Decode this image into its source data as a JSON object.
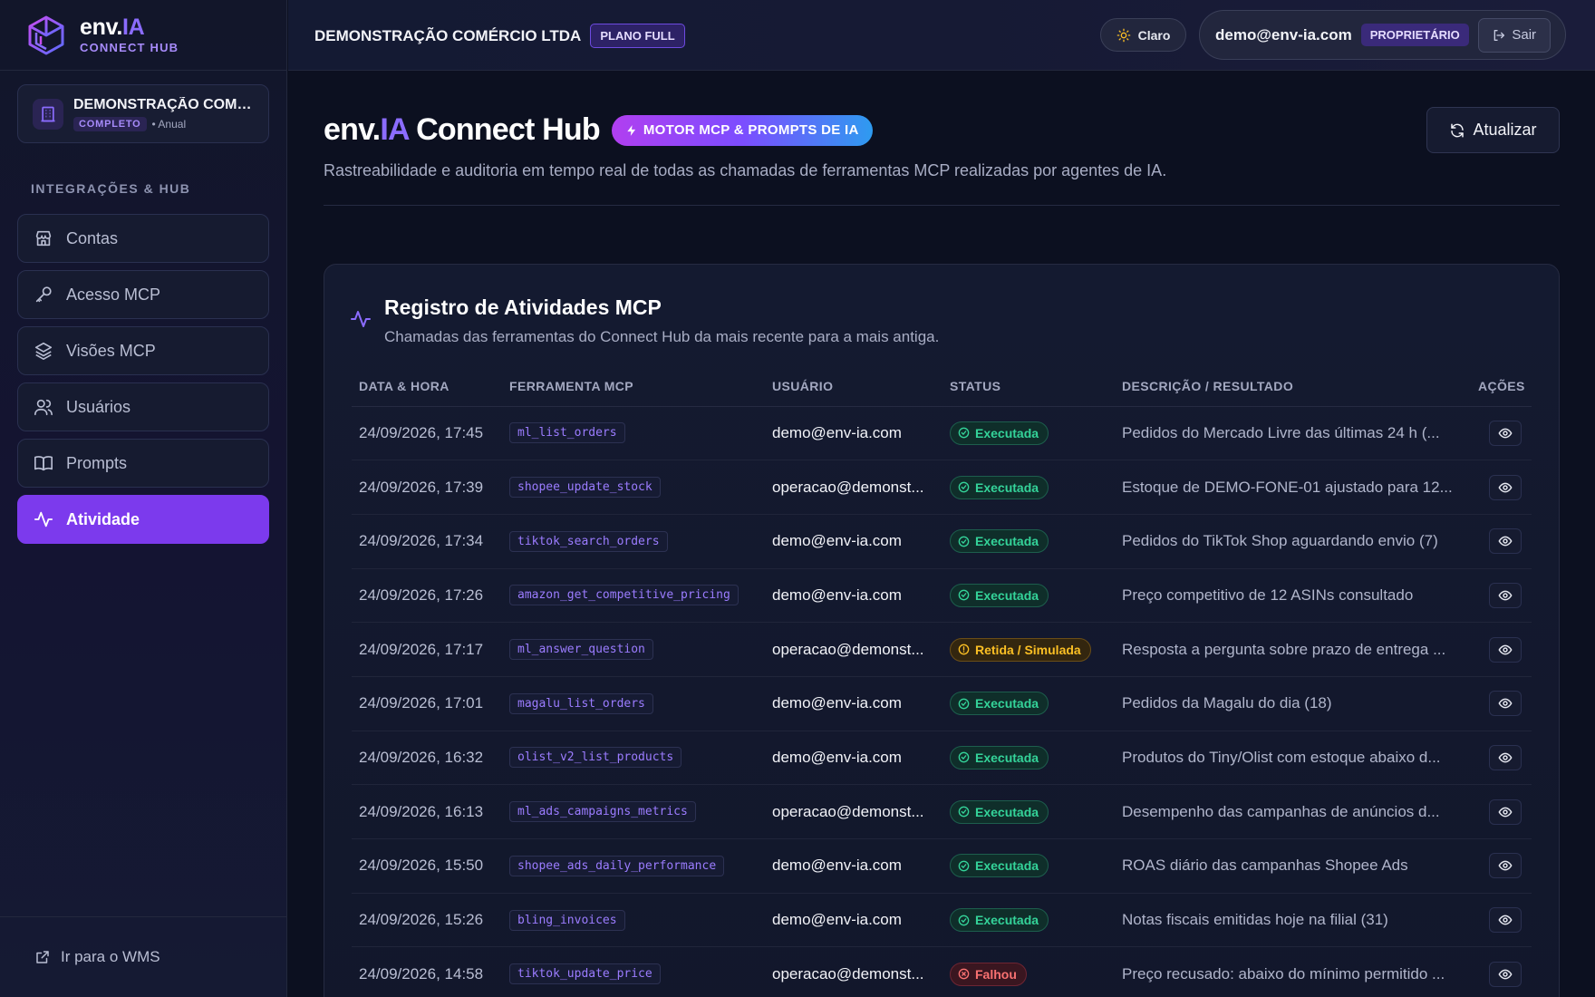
{
  "brand": {
    "name_prefix": "env.",
    "name_ia": "IA",
    "subtitle": "CONNECT HUB"
  },
  "org": {
    "name": "DEMONSTRAÇÃO COMÉRCIO LTDA",
    "plan_badge": "COMPLETO",
    "billing": "• Anual"
  },
  "sidebar": {
    "section_label": "INTEGRAÇÕES & HUB",
    "items": [
      {
        "label": "Contas",
        "icon": "store-icon",
        "active": false
      },
      {
        "label": "Acesso MCP",
        "icon": "key-icon",
        "active": false
      },
      {
        "label": "Visões MCP",
        "icon": "layers-icon",
        "active": false
      },
      {
        "label": "Usuários",
        "icon": "users-icon",
        "active": false
      },
      {
        "label": "Prompts",
        "icon": "book-icon",
        "active": false
      },
      {
        "label": "Atividade",
        "icon": "activity-icon",
        "active": true
      }
    ],
    "footer_link": "Ir para o WMS"
  },
  "header": {
    "company": "DEMONSTRAÇÃO COMÉRCIO LTDA",
    "plan": "PLANO FULL",
    "theme_label": "Claro",
    "user_email": "demo@env-ia.com",
    "role": "PROPRIETÁRIO",
    "logout_label": "Sair"
  },
  "page": {
    "title_prefix": "env.",
    "title_ia": "IA",
    "title_suffix": "Connect Hub",
    "engine_badge": "MOTOR MCP & PROMPTS DE IA",
    "subtitle": "Rastreabilidade e auditoria em tempo real de todas as chamadas de ferramentas MCP realizadas por agentes de IA.",
    "refresh_label": "Atualizar"
  },
  "activity": {
    "title": "Registro de Atividades MCP",
    "subtitle": "Chamadas das ferramentas do Connect Hub da mais recente para a mais antiga.",
    "columns": [
      "DATA & HORA",
      "FERRAMENTA MCP",
      "USUÁRIO",
      "STATUS",
      "DESCRIÇÃO / RESULTADO",
      "AÇÕES"
    ],
    "rows": [
      {
        "datetime": "24/09/2026, 17:45",
        "tool": "ml_list_orders",
        "user": "demo@env-ia.com",
        "status": "Executada",
        "status_type": "ok",
        "description": "Pedidos do Mercado Livre das últimas 24 h (..."
      },
      {
        "datetime": "24/09/2026, 17:39",
        "tool": "shopee_update_stock",
        "user": "operacao@demonst...",
        "status": "Executada",
        "status_type": "ok",
        "description": "Estoque de DEMO-FONE-01 ajustado para 12..."
      },
      {
        "datetime": "24/09/2026, 17:34",
        "tool": "tiktok_search_orders",
        "user": "demo@env-ia.com",
        "status": "Executada",
        "status_type": "ok",
        "description": "Pedidos do TikTok Shop aguardando envio (7)"
      },
      {
        "datetime": "24/09/2026, 17:26",
        "tool": "amazon_get_competitive_pricing",
        "user": "demo@env-ia.com",
        "status": "Executada",
        "status_type": "ok",
        "description": "Preço competitivo de 12 ASINs consultado"
      },
      {
        "datetime": "24/09/2026, 17:17",
        "tool": "ml_answer_question",
        "user": "operacao@demonst...",
        "status": "Retida / Simulada",
        "status_type": "warn",
        "description": "Resposta a pergunta sobre prazo de entrega ..."
      },
      {
        "datetime": "24/09/2026, 17:01",
        "tool": "magalu_list_orders",
        "user": "demo@env-ia.com",
        "status": "Executada",
        "status_type": "ok",
        "description": "Pedidos da Magalu do dia (18)"
      },
      {
        "datetime": "24/09/2026, 16:32",
        "tool": "olist_v2_list_products",
        "user": "demo@env-ia.com",
        "status": "Executada",
        "status_type": "ok",
        "description": "Produtos do Tiny/Olist com estoque abaixo d..."
      },
      {
        "datetime": "24/09/2026, 16:13",
        "tool": "ml_ads_campaigns_metrics",
        "user": "operacao@demonst...",
        "status": "Executada",
        "status_type": "ok",
        "description": "Desempenho das campanhas de anúncios d..."
      },
      {
        "datetime": "24/09/2026, 15:50",
        "tool": "shopee_ads_daily_performance",
        "user": "demo@env-ia.com",
        "status": "Executada",
        "status_type": "ok",
        "description": "ROAS diário das campanhas Shopee Ads"
      },
      {
        "datetime": "24/09/2026, 15:26",
        "tool": "bling_invoices",
        "user": "demo@env-ia.com",
        "status": "Executada",
        "status_type": "ok",
        "description": "Notas fiscais emitidas hoje na filial (31)"
      },
      {
        "datetime": "24/09/2026, 14:58",
        "tool": "tiktok_update_price",
        "user": "operacao@demonst...",
        "status": "Falhou",
        "status_type": "fail",
        "description": "Preço recusado: abaixo do mínimo permitido ..."
      }
    ]
  },
  "colors": {
    "accent": "#7c3aed",
    "ok": "#34d399",
    "warn": "#fbbf24",
    "fail": "#f87171"
  }
}
